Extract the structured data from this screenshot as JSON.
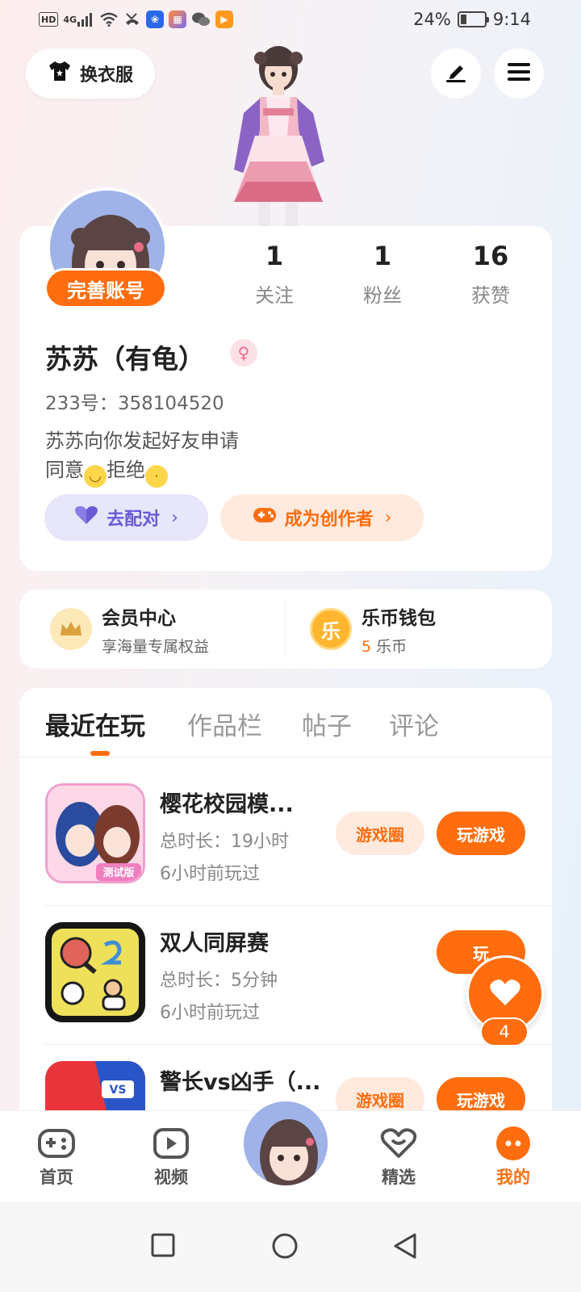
{
  "status_bar": {
    "hd": "HD",
    "signal": "4G",
    "battery": "24%",
    "time": "9:14"
  },
  "header": {
    "dress_label": "换衣服",
    "edit_icon": "edit-icon",
    "menu_icon": "menu-icon"
  },
  "profile": {
    "complete_badge": "完善账号",
    "stats": [
      {
        "num": "1",
        "label": "关注"
      },
      {
        "num": "1",
        "label": "粉丝"
      },
      {
        "num": "16",
        "label": "获赞"
      }
    ],
    "username": "苏苏（有龟）",
    "gender_icon": "female-icon",
    "uid": "233号：358104520",
    "bio_line1": "苏苏向你发起好友申请",
    "bio_line2_a": "同意",
    "bio_line2_b": "拒绝",
    "match_label": "去配对",
    "creator_label": "成为创作者"
  },
  "vip": {
    "member_title": "会员中心",
    "member_sub": "享海量专属权益",
    "wallet_title": "乐币钱包",
    "wallet_amount": "5",
    "wallet_unit": "乐币",
    "wallet_icon_char": "乐"
  },
  "tabs": [
    "最近在玩",
    "作品栏",
    "帖子",
    "评论"
  ],
  "games": [
    {
      "title": "樱花校园模...",
      "duration": "总时长：19小时",
      "last": "6小时前玩过",
      "circle": "游戏圈",
      "play": "玩游戏"
    },
    {
      "title": "双人同屏赛",
      "duration": "总时长：5分钟",
      "last": "6小时前玩过",
      "circle": "",
      "play": "玩"
    },
    {
      "title": "警长vs凶手（...",
      "duration": "",
      "last": "",
      "circle": "游戏圈",
      "play": "玩游戏"
    }
  ],
  "fab": {
    "count": "4"
  },
  "bottom_nav": {
    "home": "首页",
    "video": "视频",
    "featured": "精选",
    "mine": "我的"
  },
  "colors": {
    "accent": "#ff6d0f",
    "match": "#6b5bd6"
  }
}
